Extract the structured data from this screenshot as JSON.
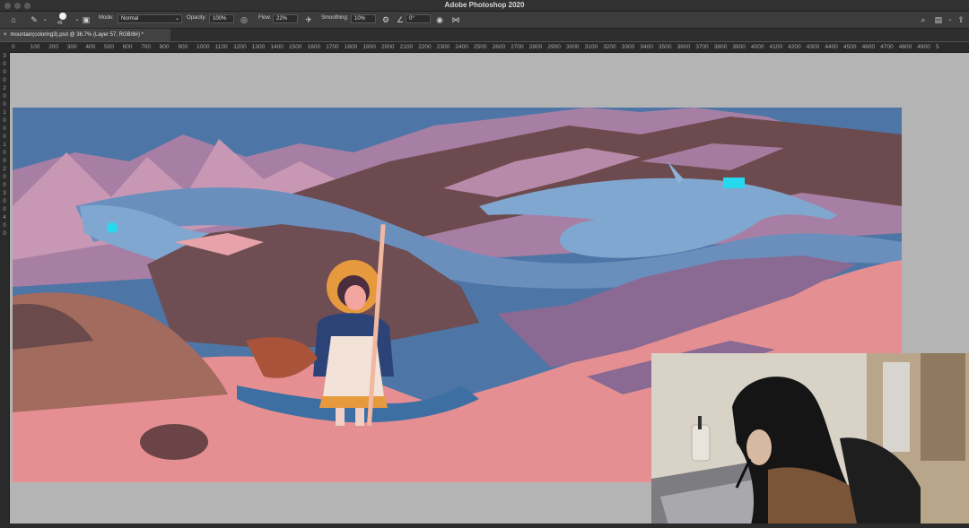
{
  "window": {
    "title": "Adobe Photoshop 2020"
  },
  "options_bar": {
    "brush_size": "45",
    "mode_label": "Mode:",
    "mode_value": "Normal",
    "opacity_label": "Opacity:",
    "opacity_value": "100%",
    "flow_label": "Flow:",
    "flow_value": "22%",
    "smoothing_label": "Smoothing:",
    "smoothing_value": "10%",
    "angle_value": "0°"
  },
  "document_tab": {
    "label": "mountain(coloring3).psd @ 36.7% (Layer 57, RGB/8#) *"
  },
  "ruler": {
    "h_ticks": [
      "0",
      "100",
      "200",
      "300",
      "400",
      "500",
      "600",
      "700",
      "800",
      "900",
      "1000",
      "1100",
      "1200",
      "1300",
      "1400",
      "1500",
      "1600",
      "1700",
      "1800",
      "1900",
      "2000",
      "2100",
      "2200",
      "2300",
      "2400",
      "2500",
      "2600",
      "2700",
      "2800",
      "2900",
      "3000",
      "3100",
      "3200",
      "3300",
      "3400",
      "3500",
      "3600",
      "3700",
      "3800",
      "3900",
      "4000",
      "4100",
      "4200",
      "4300",
      "4400",
      "4500",
      "4600",
      "4700",
      "4800",
      "4900",
      "5"
    ],
    "v_ticks": [
      "3",
      "0",
      "0",
      "0",
      "2",
      "0",
      "0",
      "1",
      "0",
      "0",
      "0",
      "1",
      "0",
      "0",
      "2",
      "0",
      "0",
      "3",
      "0",
      "0",
      "4",
      "0",
      "0"
    ]
  },
  "icons": {
    "home": "home-icon",
    "brush": "brush-icon",
    "brush_panel": "brush-panel-icon",
    "pressure_opacity": "pressure-opacity-icon",
    "airbrush": "airbrush-icon",
    "settings": "gear-icon",
    "angle": "angle-icon",
    "pressure_size": "pressure-size-icon",
    "symmetry": "butterfly-icon",
    "search": "search-icon",
    "workspace": "workspace-icon",
    "share": "share-icon"
  },
  "colors": {
    "sky": "#4d76a6",
    "snow": "#e58f92",
    "mountain": "#a87fa4",
    "rock": "#6d4a4e",
    "spirit": "#7fa7cf",
    "glow": "#27d9ef"
  }
}
